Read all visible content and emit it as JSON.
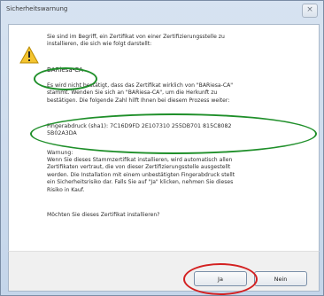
{
  "window": {
    "title": "Sicherheitswarnung",
    "close_symbol": "×"
  },
  "message": {
    "intro": "Sie sind im Begriff, ein Zertifikat von einer Zertifizierungsstelle zu\ninstallieren, die sich wie folgt darstellt:",
    "ca_name": "BARiesa-CA",
    "body1": "Es wird nicht bestätigt, dass das Zertifikat wirklich von \"BARiesa-CA\"\nstammt. Wenden Sie sich an \"BARiesa-CA\", um die Herkunft zu\nbestätigen. Die folgende Zahl hilft Ihnen bei diesem Prozess weiter:",
    "fingerprint": "Fingerabdruck (sha1): 7C16D9FD 2E107310 255DB701 815C8082\n5B02A3DA",
    "warning_heading": "Warnung:",
    "warning_body": "Wenn Sie dieses Stammzertifikat installieren, wird automatisch allen\nZertifikaten vertraut, die von dieser Zertifizierungsstelle ausgestellt\nwerden. Die Installation mit einem unbestätigten Fingerabdruck stellt\nein Sicherheitsrisiko dar. Falls Sie auf \"Ja\" klicken, nehmen Sie dieses\nRisiko in Kauf.",
    "question": "Möchten Sie dieses Zertifikat installieren?"
  },
  "buttons": {
    "yes": "Ja",
    "no": "Nein"
  },
  "icons": {
    "warning": "warning-icon",
    "close": "close-icon"
  },
  "colors": {
    "annotation_green": "#1f8f2a",
    "annotation_red": "#d32020",
    "warning_yellow": "#f4c430"
  }
}
